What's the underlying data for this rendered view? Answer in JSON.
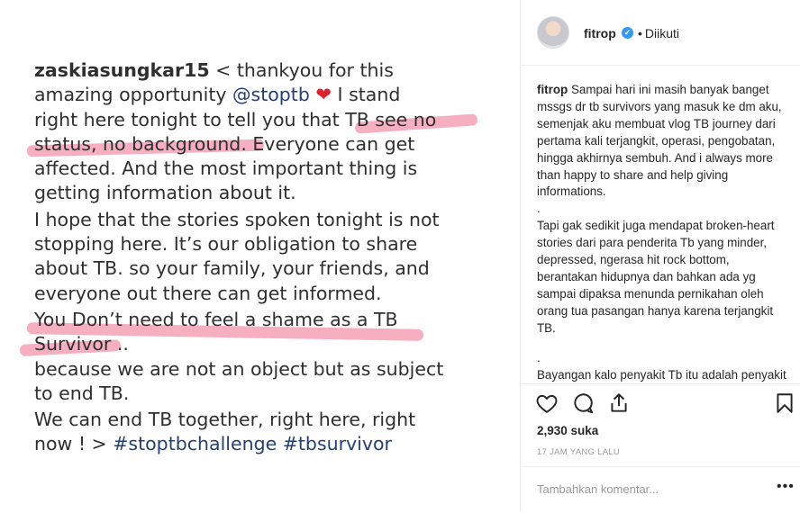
{
  "post_image": {
    "lines": [
      {
        "u": "zaskiasungkar15",
        "t": " < thankyou for this"
      },
      {
        "t": "amazing opportunity ",
        "link": "@stoptb",
        "heart": "❤",
        "t2": " I stand"
      },
      {
        "t": "right here tonight to tell you that TB see no"
      },
      {
        "t": "status, no background. Everyone can get"
      },
      {
        "t": "affected. And the most important thing is"
      },
      {
        "t": "getting information about it."
      },
      {
        "t": "I hope that the stories spoken tonight is not"
      },
      {
        "t": "stopping here. It’s our obligation to share"
      },
      {
        "t": "about TB.  so your family, your friends, and"
      },
      {
        "t": "everyone out there can get informed."
      },
      {
        "t": "You Don’t need to feel a shame as a TB"
      },
      {
        "t": "Survivor .."
      },
      {
        "t": "because we are not an object but as subject"
      },
      {
        "t": "to end TB."
      },
      {
        "t": "We can end TB together, right here, right"
      },
      {
        "t": "now ! > ",
        "link": "#stoptbchallenge #tbsurvivor"
      }
    ]
  },
  "header": {
    "username": "fitrop",
    "verified_icon": "verified-badge-icon",
    "dot": "•",
    "follow_status": "Diikuti"
  },
  "caption": {
    "username": "fitrop",
    "paragraphs": [
      "Sampai hari ini masih banyak banget mssgs dr tb survivors yang masuk ke dm aku, semenjak aku membuat vlog TB journey dari pertama kali terjangkit, operasi, pengobatan, hingga akhirnya sembuh. And i always more than happy to share and help giving informations.",
      ".",
      "Tapi gak sedikit juga mendapat broken-heart stories dari para penderita Tb yang minder, depressed, ngerasa hit rock bottom, berantakan hidupnya dan bahkan ada yg sampai dipaksa menunda pernikahan oleh orang tua pasangan hanya karena terjangkit TB.",
      ".",
      "Bayangan kalo penyakit Tb itu adalah penyakit yang jorok dan menjijikan akibat pola dan lingkungan hidup yang buruk itu"
    ]
  },
  "actions": {
    "icons": [
      "heart-icon",
      "comment-icon",
      "share-icon",
      "bookmark-icon"
    ],
    "likes": "2,930 suka",
    "time": "17 JAM YANG LALU"
  },
  "comment": {
    "placeholder": "Tambahkan komentar...",
    "more": "•••"
  },
  "colors": {
    "link": "#243f75",
    "highlight": "#ee6e8e",
    "verified": "#3897f0"
  }
}
